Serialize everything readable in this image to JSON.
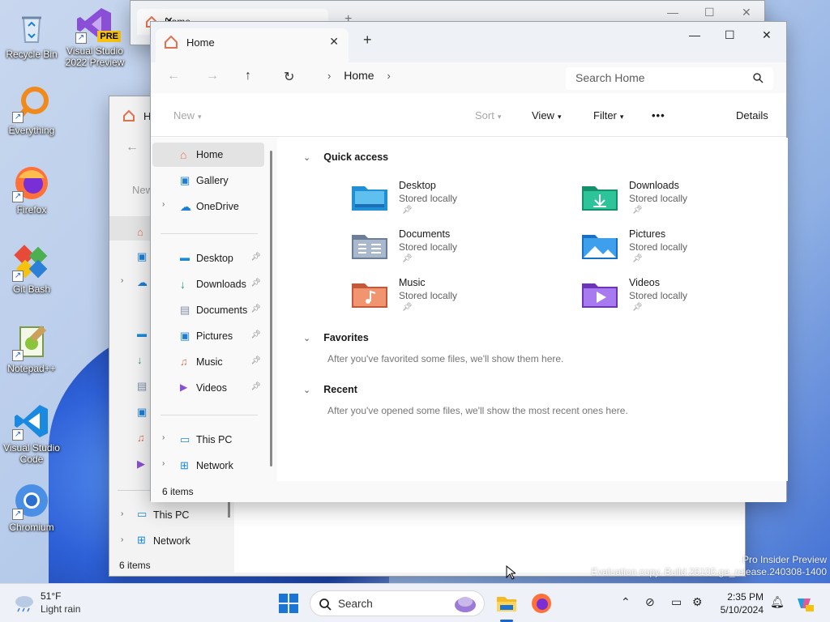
{
  "desktop": {
    "icons": [
      {
        "label": "Recycle Bin"
      },
      {
        "label": "Visual Studio 2022 Preview",
        "badge": "PRE"
      },
      {
        "label": "Everything"
      },
      {
        "label": "Firefox"
      },
      {
        "label": "Git Bash"
      },
      {
        "label": "Notepad++"
      },
      {
        "label": "Visual Studio Code"
      },
      {
        "label": "Chromium"
      }
    ],
    "watermark_line1": "Pro Insider Preview",
    "watermark_line2": "Evaluation copy. Build 26100.ge_release.240308-1400"
  },
  "back_window": {
    "tab_title": "Home"
  },
  "middle_window": {
    "tab_title_partial": "H",
    "nav_new": "New",
    "nav_this_pc": "This PC",
    "nav_network": "Network",
    "status": "6 items"
  },
  "window": {
    "tab_title": "Home",
    "new_tab": "+",
    "breadcrumb": [
      "Home"
    ],
    "search_placeholder": "Search Home",
    "commands": {
      "new": "New",
      "sort": "Sort",
      "view": "View",
      "filter": "Filter",
      "more": "•••",
      "details": "Details"
    },
    "nav": {
      "home": "Home",
      "gallery": "Gallery",
      "onedrive": "OneDrive",
      "desktop": "Desktop",
      "downloads": "Downloads",
      "documents": "Documents",
      "pictures": "Pictures",
      "music": "Music",
      "videos": "Videos",
      "this_pc": "This PC",
      "network": "Network"
    },
    "sections": {
      "quick_access": "Quick access",
      "favorites": "Favorites",
      "favorites_msg": "After you've favorited some files, we'll show them here.",
      "recent": "Recent",
      "recent_msg": "After you've opened some files, we'll show the most recent ones here."
    },
    "quick_access": [
      {
        "name": "Desktop",
        "sub": "Stored locally",
        "color": "#1f8fd6"
      },
      {
        "name": "Downloads",
        "sub": "Stored locally",
        "color": "#1aa37a"
      },
      {
        "name": "Documents",
        "sub": "Stored locally",
        "color": "#7d8fa8"
      },
      {
        "name": "Pictures",
        "sub": "Stored locally",
        "color": "#1a7fd6"
      },
      {
        "name": "Music",
        "sub": "Stored locally",
        "color": "#e0734f"
      },
      {
        "name": "Videos",
        "sub": "Stored locally",
        "color": "#8a4fd6"
      }
    ],
    "status": "6 items"
  },
  "taskbar": {
    "weather_temp": "51°F",
    "weather_desc": "Light rain",
    "search_label": "Search",
    "time": "2:35 PM",
    "date": "5/10/2024"
  }
}
